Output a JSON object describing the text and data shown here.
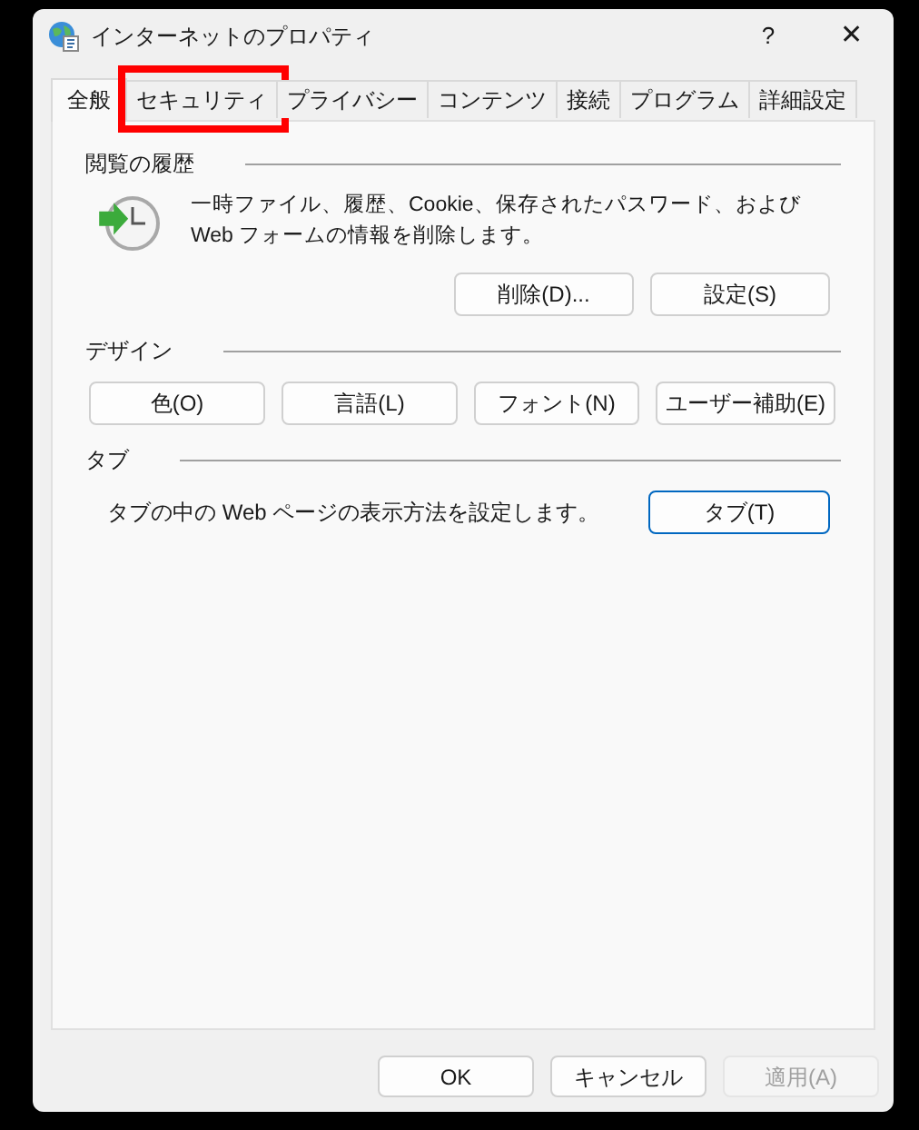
{
  "window": {
    "title": "インターネットのプロパティ",
    "help": "?",
    "close": "✕"
  },
  "tabs": [
    {
      "label": "全般",
      "selected": true,
      "highlighted": false
    },
    {
      "label": "セキュリティ",
      "selected": false,
      "highlighted": true
    },
    {
      "label": "プライバシー",
      "selected": false,
      "highlighted": false
    },
    {
      "label": "コンテンツ",
      "selected": false,
      "highlighted": false
    },
    {
      "label": "接続",
      "selected": false,
      "highlighted": false
    },
    {
      "label": "プログラム",
      "selected": false,
      "highlighted": false
    },
    {
      "label": "詳細設定",
      "selected": false,
      "highlighted": false
    }
  ],
  "sections": [
    {
      "title": "閲覧の履歴",
      "kind": "history",
      "description": "一時ファイル、履歴、Cookie、保存されたパスワード、および Web フォームの情報を削除します。",
      "buttons": [
        {
          "label": "削除(D)...",
          "default": false
        },
        {
          "label": "設定(S)",
          "default": false
        }
      ]
    },
    {
      "title": "デザイン",
      "kind": "buttons",
      "buttons": [
        {
          "label": "色(O)",
          "default": false
        },
        {
          "label": "言語(L)",
          "default": false
        },
        {
          "label": "フォント(N)",
          "default": false
        },
        {
          "label": "ユーザー補助(E)",
          "default": false
        }
      ]
    },
    {
      "title": "タブ",
      "kind": "inline",
      "description": "タブの中の Web ページの表示方法を設定します。",
      "buttons": [
        {
          "label": "タブ(T)",
          "default": true
        }
      ]
    }
  ],
  "footer_buttons": [
    {
      "label": "OK",
      "disabled": false
    },
    {
      "label": "キャンセル",
      "disabled": false
    },
    {
      "label": "適用(A)",
      "disabled": true
    }
  ]
}
